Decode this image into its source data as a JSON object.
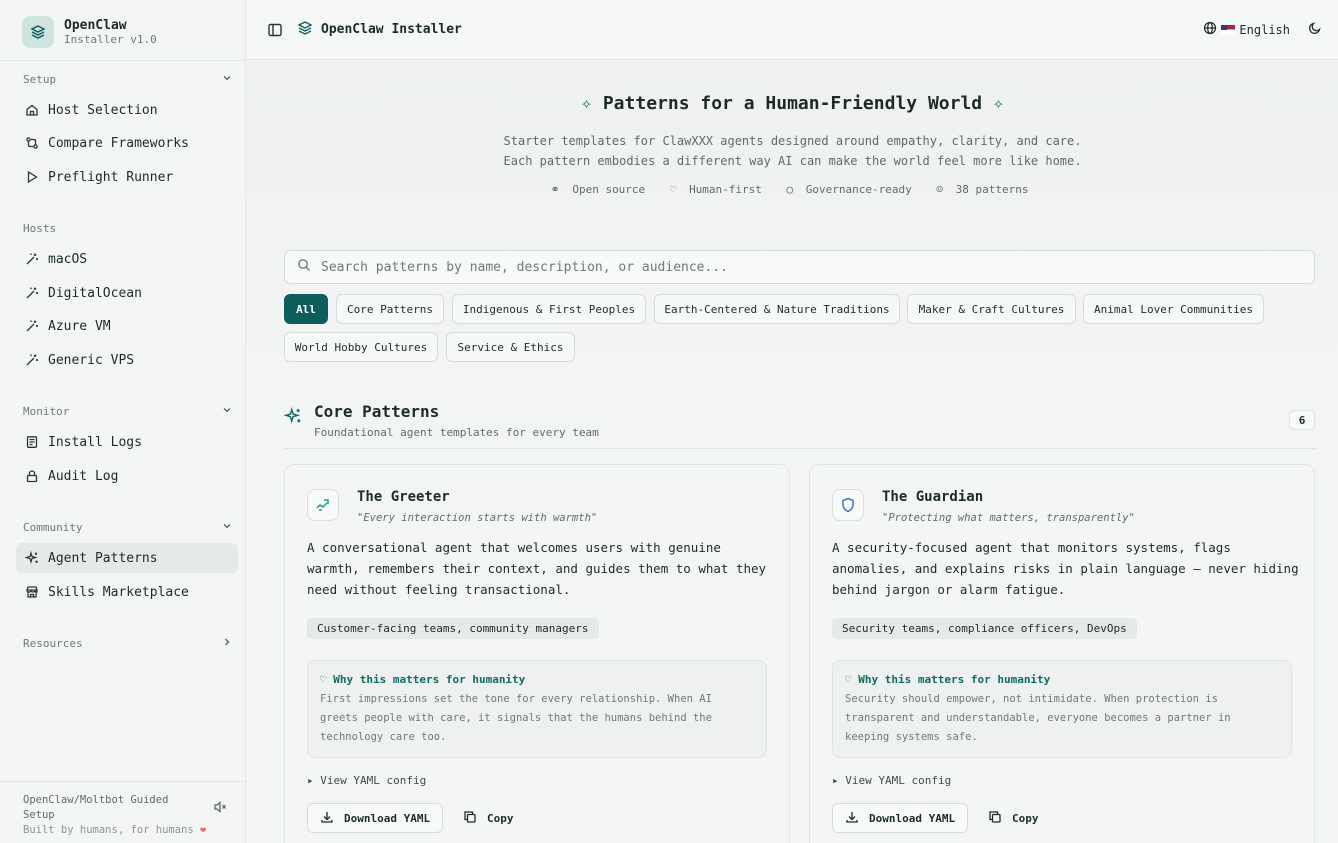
{
  "sidebar": {
    "brand": {
      "name": "OpenClaw",
      "version": "Installer v1.0"
    },
    "sections": [
      {
        "title": "Setup",
        "items": [
          "Host Selection",
          "Compare Frameworks",
          "Preflight Runner"
        ]
      },
      {
        "title": "Hosts",
        "items": [
          "macOS",
          "DigitalOcean",
          "Azure VM",
          "Generic VPS"
        ]
      },
      {
        "title": "Monitor",
        "items": [
          "Install Logs",
          "Audit Log"
        ]
      },
      {
        "title": "Community",
        "items": [
          "Agent Patterns",
          "Skills Marketplace"
        ]
      },
      {
        "title": "Resources",
        "items": []
      }
    ],
    "footer": {
      "line1": "OpenClaw/Moltbot Guided",
      "line2": "Setup",
      "line3": "Built by humans, for humans"
    }
  },
  "topbar": {
    "title": "OpenClaw Installer",
    "language": "English"
  },
  "hero": {
    "title": "Patterns for a Human-Friendly World",
    "subtitle1": "Starter templates for ClawXXX agents designed around empathy, clarity, and care.",
    "subtitle2": "Each pattern embodies a different way AI can make the world feel more like home.",
    "meta": [
      "Open source",
      "Human-first",
      "Governance-ready",
      "38 patterns"
    ]
  },
  "search": {
    "placeholder": "Search patterns by name, description, or audience..."
  },
  "filters": [
    "All",
    "Core Patterns",
    "Indigenous & First Peoples",
    "Earth-Centered & Nature Traditions",
    "Maker & Craft Cultures",
    "Animal Lover Communities",
    "World Hobby Cultures",
    "Service & Ethics"
  ],
  "section": {
    "title": "Core Patterns",
    "subtitle": "Foundational agent templates for every team",
    "count": "6"
  },
  "cards": [
    {
      "title": "The Greeter",
      "quote": "\"Every interaction starts with warmth\"",
      "description": "A conversational agent that welcomes users with genuine warmth, remembers their context, and guides them to what they need without feeling transactional.",
      "audience": "Customer-facing teams, community managers",
      "why_title": "Why this matters for humanity",
      "why_body": "First impressions set the tone for every relationship. When AI greets people with care, it signals that the humans behind the technology care too.",
      "yaml": "View YAML config",
      "download": "Download YAML",
      "copy": "Copy",
      "icon_color": "#14a38b"
    },
    {
      "title": "The Guardian",
      "quote": "\"Protecting what matters, transparently\"",
      "description": "A security-focused agent that monitors systems, flags anomalies, and explains risks in plain language — never hiding behind jargon or alarm fatigue.",
      "audience": "Security teams, compliance officers, DevOps",
      "why_title": "Why this matters for humanity",
      "why_body": "Security should empower, not intimidate. When protection is transparent and understandable, everyone becomes a partner in keeping systems safe.",
      "yaml": "View YAML config",
      "download": "Download YAML",
      "copy": "Copy",
      "icon_color": "#3b73d6"
    }
  ]
}
